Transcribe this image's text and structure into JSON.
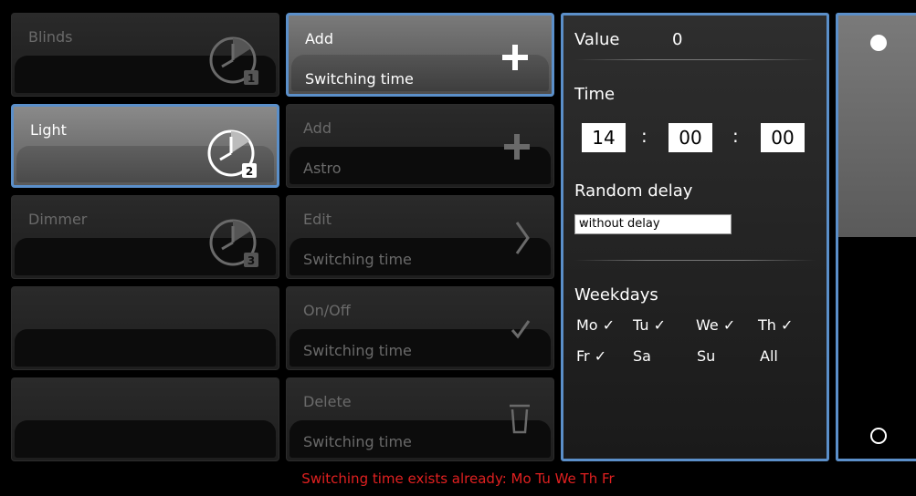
{
  "devices": [
    {
      "label": "Blinds",
      "badge": "1",
      "state": "normal"
    },
    {
      "label": "Light",
      "badge": "2",
      "state": "active"
    },
    {
      "label": "Dimmer",
      "badge": "3",
      "state": "normal"
    },
    {
      "label": "",
      "badge": "",
      "state": "empty"
    },
    {
      "label": "",
      "badge": "",
      "state": "empty"
    }
  ],
  "actions": [
    {
      "line1": "Add",
      "line2": "Switching time",
      "icon": "plus-icon",
      "state": "selected"
    },
    {
      "line1": "Add",
      "line2": "Astro",
      "icon": "plus-icon",
      "state": "normal"
    },
    {
      "line1": "Edit",
      "line2": "Switching time",
      "icon": "chevron-right-icon",
      "state": "normal"
    },
    {
      "line1": "On/Off",
      "line2": "Switching time",
      "icon": "checkmark-icon",
      "state": "normal"
    },
    {
      "line1": "Delete",
      "line2": "Switching time",
      "icon": "trash-icon",
      "state": "normal"
    }
  ],
  "panel": {
    "value_label": "Value",
    "value": "0",
    "time_label": "Time",
    "hours": "14",
    "minutes": "00",
    "seconds": "00",
    "colon": ":",
    "random_delay_label": "Random delay",
    "random_delay_value": "without delay",
    "weekdays_label": "Weekdays",
    "weekdays": [
      {
        "label": "Mo",
        "checked": true
      },
      {
        "label": "Tu",
        "checked": true
      },
      {
        "label": "We",
        "checked": true
      },
      {
        "label": "Th",
        "checked": true
      },
      {
        "label": "Fr",
        "checked": true
      },
      {
        "label": "Sa",
        "checked": false
      },
      {
        "label": "Su",
        "checked": false
      },
      {
        "label": "All",
        "checked": false
      }
    ],
    "check_mark": "✓"
  },
  "slider": {
    "level": 0.5
  },
  "status": "Switching time exists already: Mo Tu We Th Fr",
  "colors": {
    "accent": "#5b8fc9",
    "status": "#e02020"
  }
}
